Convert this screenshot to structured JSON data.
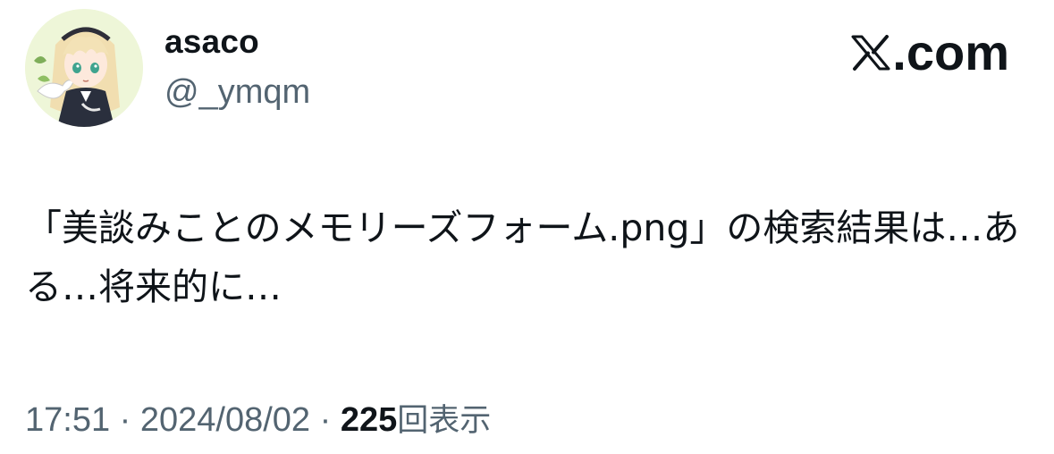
{
  "author": {
    "display_name": "asaco",
    "handle": "@_ymqm",
    "avatar_icon": "anime-girl-avatar-icon"
  },
  "brand": {
    "label": ".com",
    "icon": "x-logo-icon"
  },
  "tweet": {
    "text": "「美談みことのメモリーズフォーム.png」の検索結果は…ある…将来的に…"
  },
  "meta": {
    "time": "17:51",
    "separator": "·",
    "date": "2024/08/02",
    "views_count": "225",
    "views_label": "回表示"
  },
  "colors": {
    "text_primary": "#0f1419",
    "text_secondary": "#536471",
    "background": "#ffffff"
  }
}
